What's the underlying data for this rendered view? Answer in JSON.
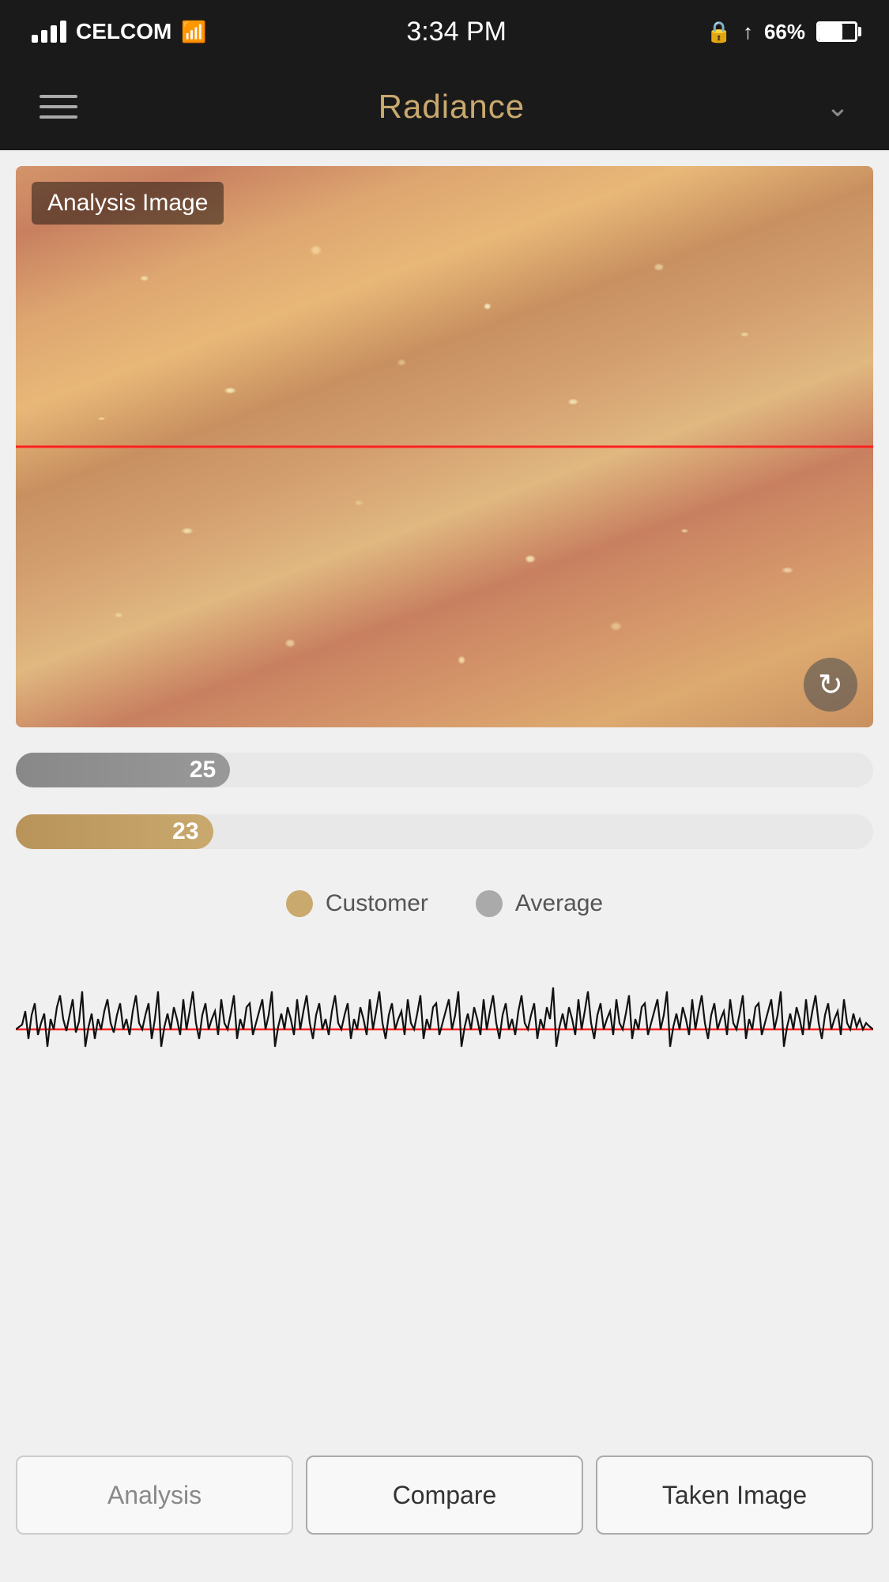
{
  "statusBar": {
    "carrier": "CELCOM",
    "time": "3:34 PM",
    "battery": "66%"
  },
  "header": {
    "title": "Radiance",
    "menuIcon": "≡",
    "chevronIcon": "∨"
  },
  "imageSection": {
    "label": "Analysis Image",
    "refreshIcon": "↺"
  },
  "bars": {
    "gray": {
      "value": "25",
      "percentage": 25
    },
    "gold": {
      "value": "23",
      "percentage": 23
    }
  },
  "legend": {
    "customerLabel": "Customer",
    "averageLabel": "Average"
  },
  "bottomNav": {
    "analysis": "Analysis",
    "compare": "Compare",
    "takenImage": "Taken Image"
  }
}
